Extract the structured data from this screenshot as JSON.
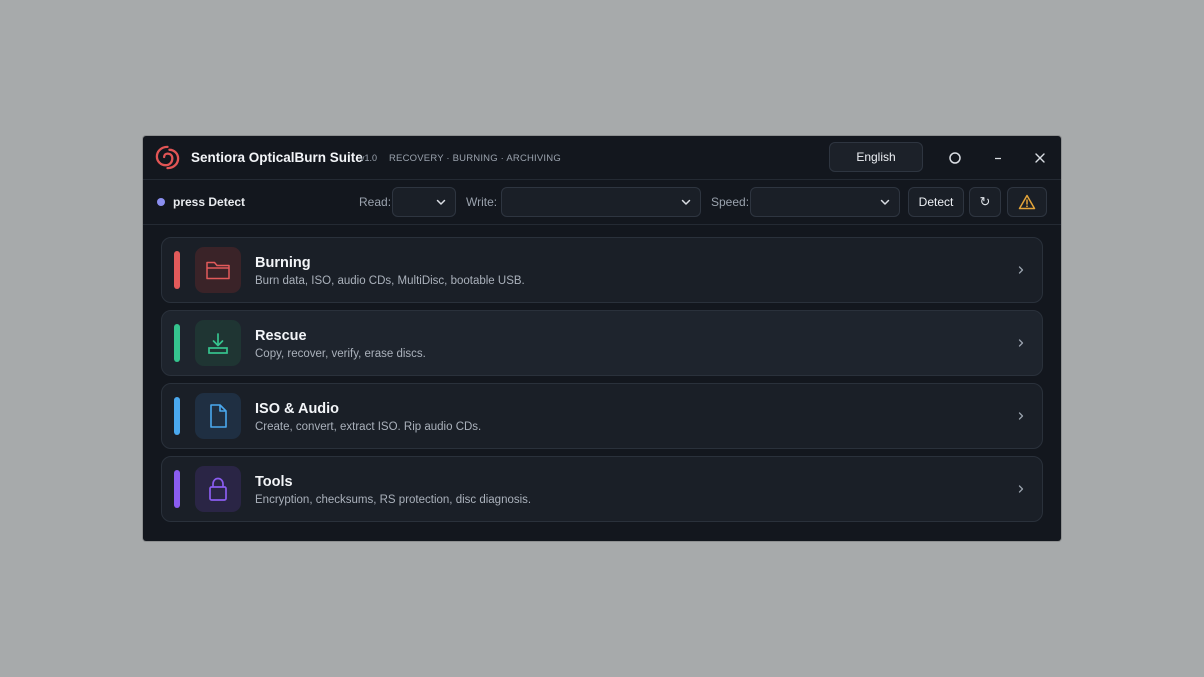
{
  "app": {
    "title": "Sentiora OpticalBurn Suite",
    "version": "v1.0",
    "tagline": "RECOVERY · BURNING · ARCHIVING",
    "accent": "#e25555"
  },
  "titlebar": {
    "language": "English",
    "icons": [
      "theme-icon",
      "minimize-icon",
      "close-icon"
    ]
  },
  "toolbar": {
    "status_text": "press Detect",
    "status_color": "#8b8ff0",
    "read_label": "Read:",
    "read_value": "",
    "write_label": "Write:",
    "write_value": "",
    "speed_label": "Speed:",
    "speed_value": "",
    "detect_label": "Detect",
    "refresh_icon": "↻",
    "warning_color": "#e3a43a"
  },
  "cards": [
    {
      "title": "Burning",
      "description": "Burn data, ISO, audio CDs, MultiDisc, bootable USB.",
      "color": "#e25a5a",
      "tile_bg": "#3a2328",
      "icon": "folder-icon"
    },
    {
      "title": "Rescue",
      "description": "Copy, recover, verify, erase discs.",
      "color": "#35c48e",
      "tile_bg": "#1f3533",
      "icon": "download-icon"
    },
    {
      "title": "ISO & Audio",
      "description": "Create, convert, extract ISO. Rip audio CDs.",
      "color": "#4aa8ee",
      "tile_bg": "#1f2f42",
      "icon": "file-icon"
    },
    {
      "title": "Tools",
      "description": "Encryption, checksums, RS protection, disc diagnosis.",
      "color": "#8a5cf0",
      "tile_bg": "#2a2545",
      "icon": "lock-icon"
    }
  ]
}
